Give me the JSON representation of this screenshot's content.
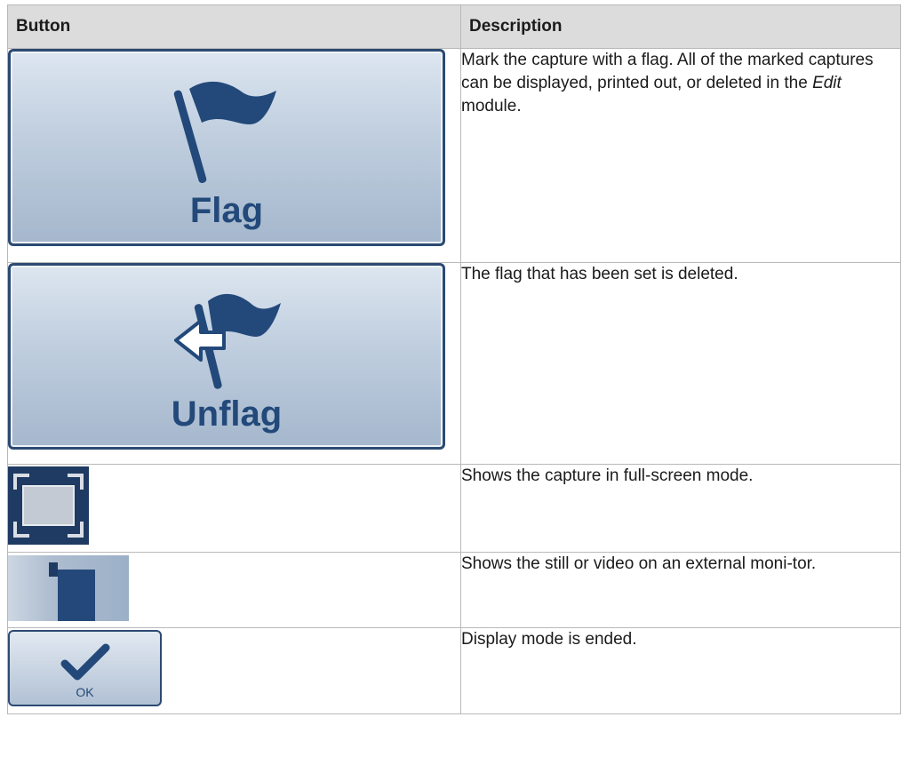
{
  "table": {
    "headers": {
      "button": "Button",
      "description": "Description"
    },
    "rows": [
      {
        "button_label": "Flag",
        "icon": "flag-icon",
        "description": {
          "pre": "Mark the capture with a flag. All of the marked captures can be displayed, printed out, or deleted in the ",
          "emph": "Edit",
          "post": " module."
        }
      },
      {
        "button_label": "Unflag",
        "icon": "unflag-icon",
        "description": "The flag that has been set is deleted."
      },
      {
        "icon": "fullscreen-icon",
        "description": "Shows the capture in full-screen mode."
      },
      {
        "icon": "external-monitor-icon",
        "description": "Shows the still or video on an external moni-tor."
      },
      {
        "button_label": "OK",
        "icon": "checkmark-icon",
        "description": "Display mode is ended."
      }
    ]
  },
  "colors": {
    "button_text": "#23497a",
    "button_border": "#2c4a72",
    "icon_dark": "#1f3b63",
    "header_bg": "#dcdcdc"
  }
}
